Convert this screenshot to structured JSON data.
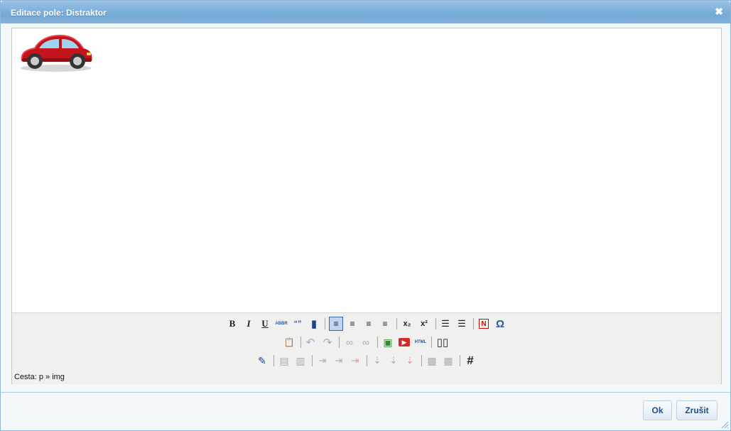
{
  "dialog": {
    "title": "Editace pole: Distraktor",
    "close_glyph": "✖"
  },
  "editor": {
    "image_alt": "car-image",
    "path_label": "Cesta: p » img"
  },
  "toolbar": {
    "row1": [
      {
        "name": "bold-icon",
        "glyph": "B"
      },
      {
        "name": "italic-icon",
        "glyph": "I"
      },
      {
        "name": "underline-icon",
        "glyph": "U"
      },
      {
        "name": "abbr-icon",
        "glyph": "ABBR"
      },
      {
        "name": "quote-icon",
        "glyph": "“”"
      },
      {
        "name": "book-icon",
        "glyph": "▮"
      },
      {
        "name": "align-left-icon",
        "glyph": "≡"
      },
      {
        "name": "align-center-icon",
        "glyph": "≡"
      },
      {
        "name": "align-right-icon",
        "glyph": "≡"
      },
      {
        "name": "align-justify-icon",
        "glyph": "≡"
      },
      {
        "name": "subscript-icon",
        "glyph": "x₂"
      },
      {
        "name": "superscript-icon",
        "glyph": "x²"
      },
      {
        "name": "bullet-list-icon",
        "glyph": "☰"
      },
      {
        "name": "numbered-list-icon",
        "glyph": "☰"
      },
      {
        "name": "no-format-icon",
        "glyph": "N"
      },
      {
        "name": "special-char-icon",
        "glyph": "Ω"
      }
    ],
    "row2": [
      {
        "name": "paste-word-icon",
        "glyph": "📋"
      },
      {
        "name": "undo-icon",
        "glyph": "↶"
      },
      {
        "name": "redo-icon",
        "glyph": "↷"
      },
      {
        "name": "link-icon",
        "glyph": "∞"
      },
      {
        "name": "unlink-icon",
        "glyph": "∞"
      },
      {
        "name": "image-icon",
        "glyph": "▣"
      },
      {
        "name": "youtube-icon",
        "glyph": "▶"
      },
      {
        "name": "html-icon",
        "glyph": "HTML"
      },
      {
        "name": "columns-icon",
        "glyph": "▯▯"
      }
    ],
    "row3": [
      {
        "name": "edit-icon",
        "glyph": "✎"
      },
      {
        "name": "table-props-icon",
        "glyph": "▤"
      },
      {
        "name": "cell-props-icon",
        "glyph": "▥"
      },
      {
        "name": "row-before-icon",
        "glyph": "⇥"
      },
      {
        "name": "row-after-icon",
        "glyph": "⇥"
      },
      {
        "name": "delete-row-icon",
        "glyph": "⇥"
      },
      {
        "name": "col-before-icon",
        "glyph": "⇣"
      },
      {
        "name": "col-after-icon",
        "glyph": "⇣"
      },
      {
        "name": "delete-col-icon",
        "glyph": "⇣"
      },
      {
        "name": "split-cells-icon",
        "glyph": "▦"
      },
      {
        "name": "merge-cells-icon",
        "glyph": "▦"
      },
      {
        "name": "table-grid-icon",
        "glyph": "#"
      }
    ]
  },
  "buttons": {
    "ok": "Ok",
    "cancel": "Zrušit"
  },
  "colors": {
    "title_bar": "#7aaedb",
    "button_text": "#1f4f86",
    "youtube_red": "#d42a2a"
  }
}
